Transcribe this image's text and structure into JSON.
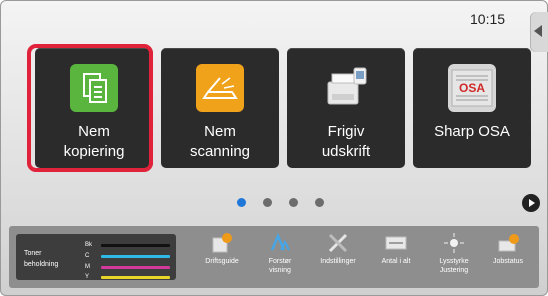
{
  "clock": "10:15",
  "tiles": [
    {
      "label_line1": "Nem",
      "label_line2": "kopiering"
    },
    {
      "label_line1": "Nem",
      "label_line2": "scanning"
    },
    {
      "label_line1": "Frigiv",
      "label_line2": "udskrift"
    },
    {
      "label_line1": "",
      "label_line2": "Sharp OSA"
    }
  ],
  "tile_icon_text": {
    "osa": "OSA"
  },
  "pager": {
    "active": 1,
    "count": 4
  },
  "toner": {
    "title_line1": "Toner",
    "title_line2": "beholdning",
    "rows": [
      {
        "code": "Bk",
        "color": "#111111"
      },
      {
        "code": "C",
        "color": "#2fb9e6"
      },
      {
        "code": "M",
        "color": "#d13a9a"
      },
      {
        "code": "Y",
        "color": "#e8d52a"
      }
    ]
  },
  "tools": [
    {
      "label_line1": "Driftsguide",
      "label_line2": ""
    },
    {
      "label_line1": "Forstør",
      "label_line2": "visning"
    },
    {
      "label_line1": "Indstillinger",
      "label_line2": ""
    },
    {
      "label_line1": "Antal i alt",
      "label_line2": ""
    },
    {
      "label_line1": "Lysstyrke",
      "label_line2": "Justering"
    },
    {
      "label_line1": "Jobstatus",
      "label_line2": ""
    }
  ],
  "colors": {
    "selection": "#e0223a",
    "copy_icon": "#59b53d",
    "scan_icon": "#f0a21a",
    "pager_active": "#1f78d8"
  },
  "icons": [
    "side-collapse-arrow-icon",
    "copy-icon",
    "scan-icon",
    "printer-icon",
    "sharp-osa-icon",
    "next-arrow-icon",
    "operation-guide-icon",
    "magnify-view-icon",
    "settings-icon",
    "counter-icon",
    "brightness-icon",
    "job-status-icon"
  ]
}
